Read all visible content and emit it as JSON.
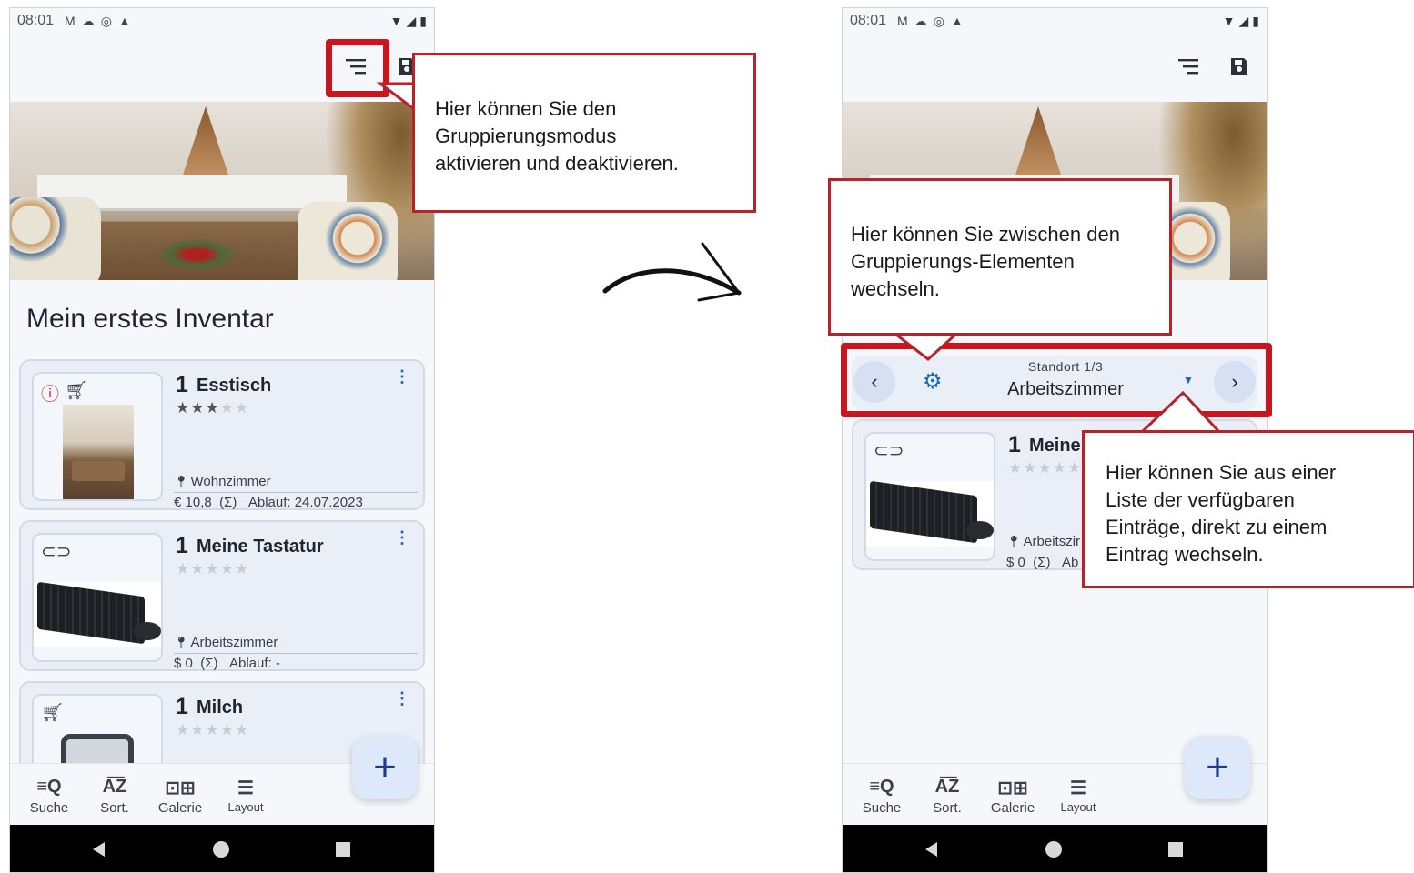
{
  "status_bar": {
    "time": "08:01",
    "icons": [
      "gmail-icon",
      "cloud-icon",
      "sync-icon",
      "cloud-upload-icon"
    ],
    "right_icons": [
      "wifi-icon",
      "signal-icon",
      "battery-icon"
    ]
  },
  "inventory_title": "Mein erstes Inventar",
  "cards": [
    {
      "qty": "1",
      "name": "Esstisch",
      "rating": 3,
      "location": "Wohnzimmer",
      "price": "€ 10,8",
      "sum": "(Σ)",
      "expiry": "Ablauf: 24.07.2023",
      "icons": [
        "alert-icon",
        "cart-icon"
      ]
    },
    {
      "qty": "1",
      "name": "Meine Tastatur",
      "rating": 0,
      "location": "Arbeitszimmer",
      "price": "$ 0",
      "sum": "(Σ)",
      "expiry": "Ablauf: -",
      "icons": [
        "link-icon"
      ]
    },
    {
      "qty": "1",
      "name": "Milch",
      "rating": 0,
      "icons": [
        "cart-icon"
      ]
    }
  ],
  "right_card": {
    "qty": "1",
    "name": "Meine",
    "location": "Arbeitszir",
    "price": "$ 0",
    "sum": "(Σ)",
    "expiry": "Ab"
  },
  "group_bar": {
    "label": "Standort 1/3",
    "value": "Arbeitszimmer"
  },
  "bottom_nav": [
    {
      "label": "Suche",
      "icon": "search-list-icon"
    },
    {
      "label": "Sort.",
      "icon": "sort-az-icon"
    },
    {
      "label": "Galerie",
      "icon": "gallery-icon"
    },
    {
      "label": "Layout",
      "icon": "layout-list-icon"
    }
  ],
  "fab_label": "+",
  "callouts": {
    "group_mode": [
      "Hier können Sie den",
      "Gruppierungsmodus",
      "aktivieren und deaktivieren."
    ],
    "switch_elements": [
      "Hier können Sie zwischen den",
      "Gruppierungs-Elementen",
      "wechseln."
    ],
    "dropdown": [
      "Hier können Sie aus einer",
      "Liste der verfügbaren",
      "Einträge, direkt zu einem",
      "Eintrag wechseln."
    ]
  },
  "colors": {
    "highlight": "#c8151e",
    "accent": "#1565c0",
    "card_bg": "#e9eef7",
    "fab_bg": "#dde8fb"
  }
}
